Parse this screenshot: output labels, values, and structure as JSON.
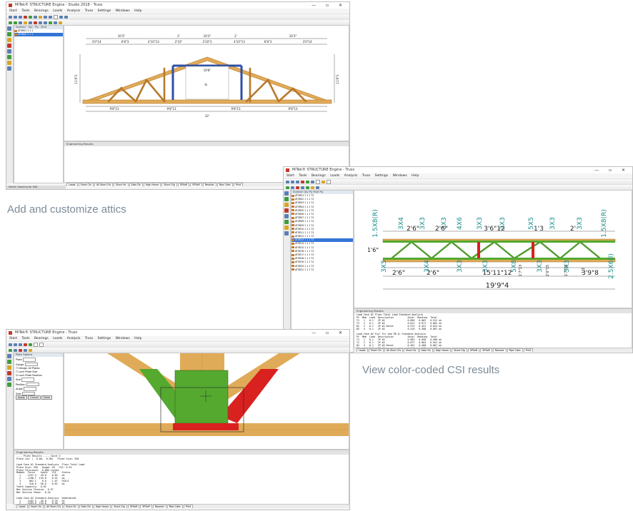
{
  "captions": {
    "attics": "Add and customize attics",
    "csi": "View color-coded CSI results"
  },
  "windows": {
    "w1": {
      "title": "MiTek® STRUCTURE Engine - Studio 2018 - Truss",
      "menu": [
        "Start",
        "Tools",
        "Bearings",
        "Loads",
        "Analysis",
        "Truss",
        "Settings",
        "Windows",
        "Help"
      ],
      "status": "Select Opening for Edit",
      "tabs": [
        "Loads",
        "Short Cfv",
        "All Short Cfs",
        "Short Hv",
        "Slab Cfs",
        "High Hover",
        "Short Cfg",
        "SPSeR",
        "SPSeR",
        "Resolve",
        "Pipe Cdes",
        "Print"
      ]
    },
    "w2": {
      "title": "MiTek® STRUCTURE Engine - Truss",
      "menu": [
        "Start",
        "Tools",
        "Bearings",
        "Loads",
        "Analysis",
        "Truss",
        "Settings",
        "Windows",
        "Help"
      ],
      "tabs": [
        "Loads",
        "Short Cfv",
        "All Short Cfs",
        "Short Hv",
        "Slab Cfs",
        "High Hover",
        "Short Cfg",
        "SPSeR",
        "SPSeR",
        "Resolve",
        "Pipe Cdes",
        "Print"
      ],
      "members_header": [
        "Number",
        "Qty",
        "Ply",
        "Mult",
        "Pg"
      ],
      "members": [
        [
          "ATSR01",
          "1",
          "1",
          "1",
          "72"
        ],
        [
          "ATSR02",
          "1",
          "1",
          "1",
          "72"
        ],
        [
          "ATSR03",
          "1",
          "1",
          "1",
          "72"
        ],
        [
          "ATSR04",
          "1",
          "1",
          "1",
          "72"
        ],
        [
          "ATSR05",
          "1",
          "1",
          "1",
          "72"
        ],
        [
          "ATSR06",
          "1",
          "1",
          "1",
          "72"
        ],
        [
          "ATSR07",
          "1",
          "1",
          "1",
          "72"
        ],
        [
          "ATSR08",
          "1",
          "1",
          "1",
          "72"
        ],
        [
          "ATSR09",
          "1",
          "1",
          "1",
          "72"
        ],
        [
          "ATSR10",
          "1",
          "1",
          "1",
          "72"
        ],
        [
          "ATSR11",
          "1",
          "1",
          "1",
          "72"
        ],
        [
          "ATSR12",
          "1",
          "1",
          "1",
          "72"
        ],
        [
          "ATSR13",
          "1",
          "1",
          "1",
          "72"
        ],
        [
          "ATSR14",
          "1",
          "1",
          "1",
          "72"
        ],
        [
          "ATSR15",
          "1",
          "1",
          "1",
          "72"
        ],
        [
          "ATSR16",
          "1",
          "1",
          "1",
          "72"
        ],
        [
          "ATSR17",
          "1",
          "1",
          "1",
          "72"
        ],
        [
          "ATSR18",
          "1",
          "1",
          "1",
          "72"
        ],
        [
          "ATSR19",
          "1",
          "1",
          "1",
          "72"
        ],
        [
          "ATSR20",
          "1",
          "1",
          "1",
          "72"
        ],
        [
          "ATSR21",
          "1",
          "1",
          "1",
          "72"
        ]
      ],
      "console_title": "Engineering Results",
      "console_lines": [
        "Load Case #1 Floor Total Load Standard Analysis",
        "Pt  Mem  Load  Description          Axial  Bending  Total",
        "T1   1   0.1   2P #2                0.850   0.062   0.912 ok",
        "T2   2   0.1   2P #2                0.811   0.071   0.882 ok",
        "B1   3   0.1   2P #2 Dense          0.372   0.451   0.823 ok",
        "B2   4   0.1   2P #2                0.419   0.388   0.807 ok",
        "",
        "Load Case #2 Full Fir and PB IL Standard Analysis",
        "Pt  Mem  Load  Description          Axial  Bending  Total",
        "T1   1   0.1   2P #2                0.902   0.058   0.960 ok",
        "T2   2   0.1   2P #2                0.877   0.064   0.941 ok",
        "B1   3   0.1   2P #2 Dense          0.401   0.466   0.867 ok",
        "B2   4   0.1   2P #2                0.446   0.402   0.848 ok",
        "",
        "Load Case #3 Full PB and Fir IL Standard Analysis",
        "Pt  Mem  Load  Description          Axial  Bending  Total",
        "T1   1   0.1   2P #2                0.866   0.060   0.926 ok",
        "B1   3   0.1   2P #2 Dense          0.388   0.459   0.847 ok",
        "",
        "Load Case #4 Unbalanced Load #1 Standard Analysis"
      ]
    },
    "w3": {
      "title": "MiTek® STRUCTURE Engine - Truss",
      "menu": [
        "Start",
        "Tools",
        "Bearings",
        "Loads",
        "Analysis",
        "Truss",
        "Settings",
        "Windows",
        "Help"
      ],
      "tabs": [
        "Loads",
        "Short Cfv",
        "All Short Cfs",
        "Short Hv",
        "Slab Cfs",
        "High Hover",
        "Short Cfg",
        "SPSeR",
        "SPSeR",
        "Resolve",
        "Pipe Cdes",
        "Print"
      ],
      "left_panel_title": "Plate Options",
      "fields": [
        "Plate",
        "Gauge",
        "Size",
        "Position",
        "Angle",
        "Side"
      ],
      "checks": [
        "Design All Plates",
        "Lock Plate Size",
        "Lock Plate Position"
      ],
      "buttons": [
        "Apply",
        "Cancel",
        "Done"
      ],
      "console_title": "Engineering Results",
      "console_lines": [
        "---- Plate Results ---- Joint 3",
        "Plate Loc: (  0.00,  0.00)   Plate Size: 5X8",
        "",
        "Load Case #1 Standard Analysis  Floor Total Load",
        "Plate Size: 5X8   Gauge: 20   CSI: 0.91",
        "Plate Tolerance:  0.000 inches",
        "Member  Force    Angle   CSI    Status",
        "  1    -1237.4   45.0    0.83   ok",
        "  2    -1198.7  135.0    0.91   ok",
        "  3      862.1    0.0    1.07   FAILS",
        "  4      410.6   90.0    0.62   ok",
        "Tooth Capacity:  0.62",
        "Net Section Tension:  0.57",
        "Net Section Shear:  0.44",
        "",
        "Load Case #2 Standard Analysis  Unbalanced",
        "  1    -1102.3   45.0    0.79   ok",
        "  2    -1264.0  135.0    0.96   ok",
        "  3      908.5    0.0    1.12   FAILS",
        "  4      389.2   90.0    0.58   ok"
      ]
    }
  },
  "truss1": {
    "dims_top": [
      "10'3\"",
      "2'",
      "10'3\"",
      "2'",
      "10'3\""
    ],
    "dims_mid": [
      "3'0\"14",
      "6'8\"3",
      "4'10\"13",
      "2'10\"",
      "3'10\"3",
      "4'10\"13",
      "6'8\"3",
      "3'0\"14"
    ],
    "dims_bottom": [
      "9'8\"13",
      "9'8\"13",
      "9'8\"13",
      "9'8\"13"
    ],
    "span": "32'",
    "room": "10'8\"",
    "room_h": "8'",
    "heights": [
      "11'6\"2",
      "11'6\"2"
    ]
  },
  "truss2": {
    "top_dims": [
      "2'6\"",
      "2'6\"",
      "3'6\"12",
      "1'3",
      "2'"
    ],
    "bottom_dims": [
      "2'6\"",
      "2'6\"",
      "15'11\"12",
      "3'9\"8"
    ],
    "overall": "19'9\"4",
    "depth": "1'6\"",
    "plates_top": [
      "1.5X8(R)",
      "3X4",
      "3X3",
      "3X3",
      "4X6",
      "3X3",
      "3X3",
      "5X5",
      "3X3",
      "3X3",
      "1.5X8(R)"
    ],
    "plates_bottom": [
      "3X5",
      "3X4",
      "3X3",
      "3X3",
      "5X8",
      "3X3",
      "3X3",
      "2.5X6(l)"
    ],
    "web_dims": [
      "1'7\"13",
      "2'0\"15",
      "1'7\"13",
      "1'3"
    ]
  },
  "colors": {
    "lumber": "#e0ab58",
    "web_green": "#54a92e",
    "fail_red": "#d9211f",
    "plate_teal": "#1a8c8c",
    "select_blue": "#3375d6"
  }
}
